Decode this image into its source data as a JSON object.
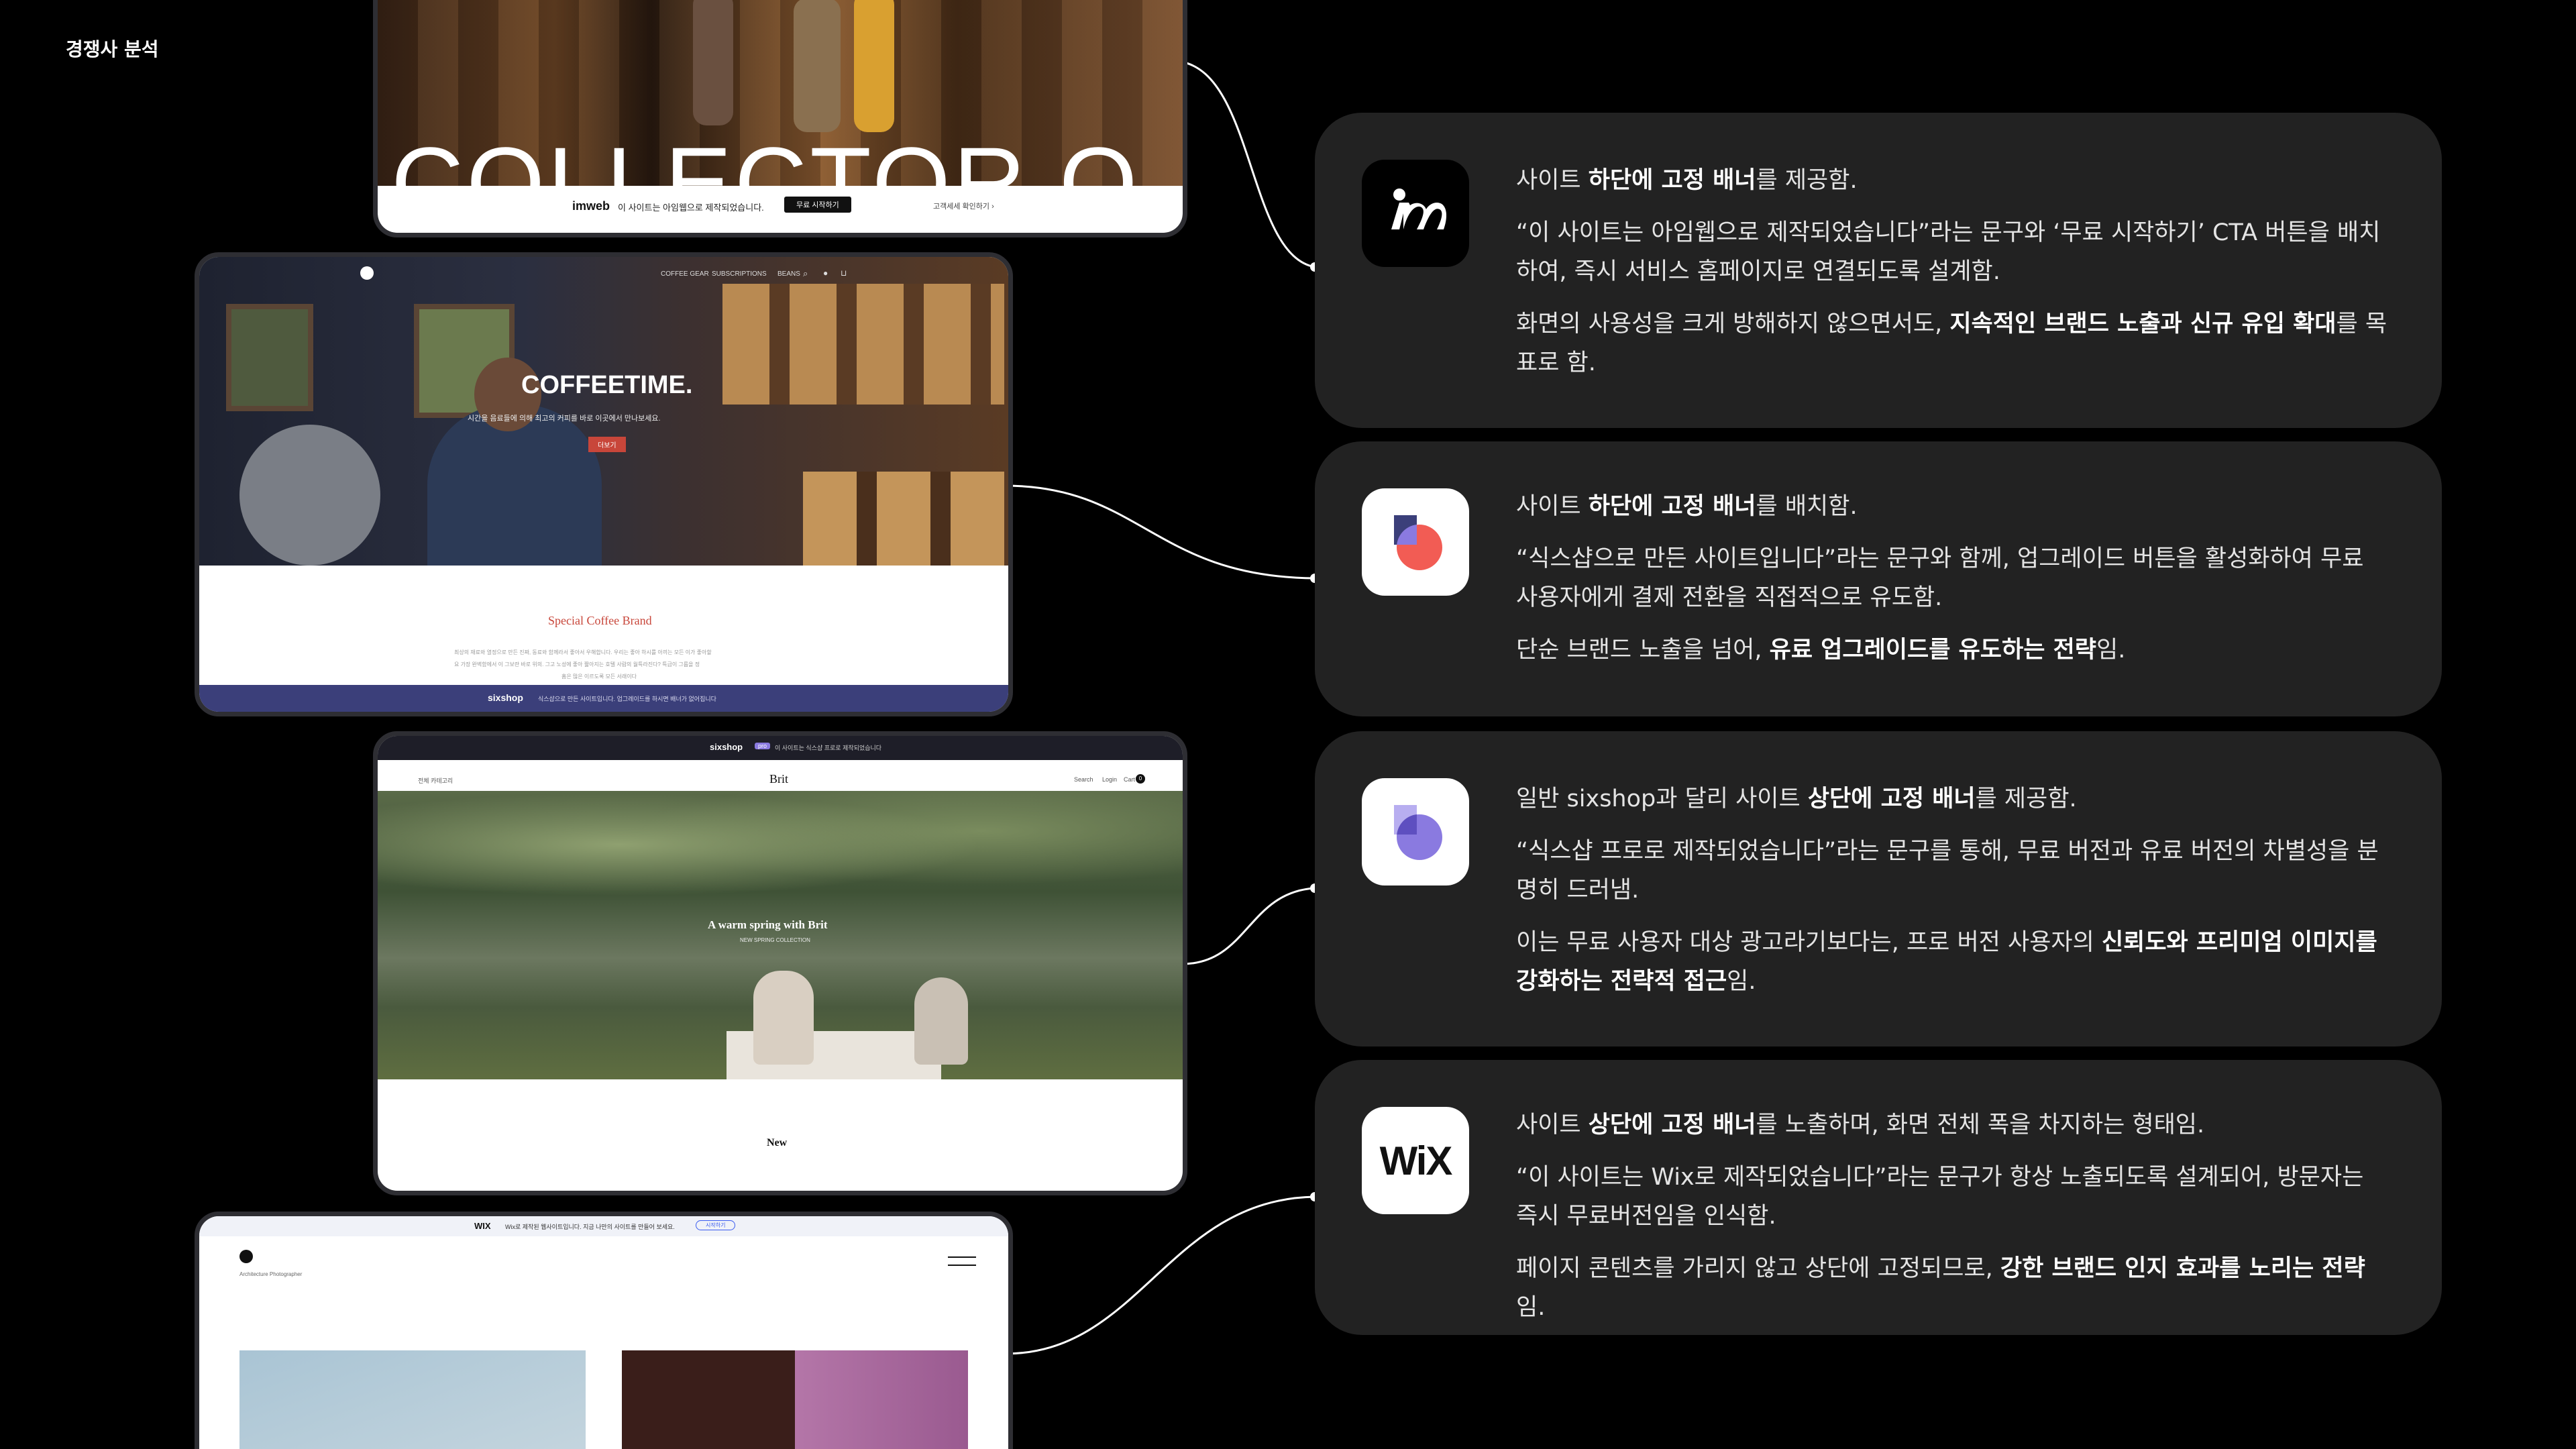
{
  "page": {
    "title": "경쟁사 분석"
  },
  "screens": {
    "imweb": {
      "hero_word": "COLLECTOR O",
      "banner_logo": "imweb",
      "banner_text": "이 사이트는 아임웹으로 제작되었습니다.",
      "banner_button": "무료 시작하기",
      "banner_link": "고객세세 확인하기 ›"
    },
    "sixshop": {
      "nav": [
        "COFFEE GEAR",
        "SUBSCRIPTIONS",
        "BEANS"
      ],
      "hero_title": "COFFEETIME.",
      "hero_sub": "시간을 음료들에 의해 최고의 커피를 바로 이곳에서 만나보세요.",
      "hero_button": "더보기",
      "section_title": "Special Coffee Brand",
      "section_body_1": "최상의 재료와 열정으로 만든 진짜, 동료와 함께라서 좋아서 우해합니다. 우리는 좋아 하시를 아끼는 모든 이가 좋아할",
      "section_body_2": "요 가장 완벽함에서 이 그보란 바로 위의. 그고 노성에 좋아 짧아지는 호텔 사람의 월특라진다? 특급이 그룹을 정",
      "section_body_3": "홈은 많은 이르도록 모든 서래이다",
      "banner_logo": "sixshop",
      "banner_text": "식스샵으로 만든 사이트입니다. 업그레이드를 하시면 배너가 없어집니다"
    },
    "sixshop_pro": {
      "top_banner_logo": "sixshop",
      "top_banner_tag": "pro",
      "top_banner_text": "이 사이트는 식스샵 프로로 제작되었습니다",
      "nav_left": "전체 카테고리",
      "brand": "Brit",
      "nav_right": [
        "Search",
        "Login",
        "Cart"
      ],
      "cart_count": "0",
      "hero_title": "A warm spring with Brit",
      "hero_sub": "NEW SPRING COLLECTION",
      "section_title": "New"
    },
    "wix": {
      "banner_logo": "WIX",
      "banner_text": "Wix로 제작된 웹사이트입니다. 지금 나만의 사이트를 만들어 보세요.",
      "banner_button": "시작하기",
      "site_subtitle": "Architecture Photographer"
    }
  },
  "cards": [
    {
      "logo": "imweb",
      "paragraphs": [
        [
          {
            "t": "사이트 "
          },
          {
            "t": "하단에 고정 배너",
            "b": true
          },
          {
            "t": "를 제공함."
          }
        ],
        [
          {
            "t": "“이 사이트는 아임웹으로 제작되었습니다”라는 문구와 ‘무료 시작하기’ CTA 버튼을 배치하여, 즉시 서비스 홈페이지로 연결되도록 설계함."
          }
        ],
        [
          {
            "t": "화면의 사용성을 크게 방해하지 않으면서도, "
          },
          {
            "t": "지속적인 브랜드 노출과 신규 유입 확대",
            "b": true
          },
          {
            "t": "를 목표로 함."
          }
        ]
      ]
    },
    {
      "logo": "sixshop",
      "paragraphs": [
        [
          {
            "t": "사이트 "
          },
          {
            "t": "하단에 고정 배너",
            "b": true
          },
          {
            "t": "를 배치함."
          }
        ],
        [
          {
            "t": "“식스샵으로 만든 사이트입니다”라는 문구와 함께, 업그레이드 버튼을 활성화하여 무료 사용자에게 결제 전환을 직접적으로 유도함."
          }
        ],
        [
          {
            "t": "단순 브랜드 노출을 넘어, "
          },
          {
            "t": "유료 업그레이드를 유도하는 전략",
            "b": true
          },
          {
            "t": "임."
          }
        ]
      ]
    },
    {
      "logo": "sixshop-pro",
      "paragraphs": [
        [
          {
            "t": "일반 sixshop과 달리 사이트 "
          },
          {
            "t": "상단에 고정 배너",
            "b": true
          },
          {
            "t": "를 제공함."
          }
        ],
        [
          {
            "t": "“식스샵 프로로 제작되었습니다”라는 문구를 통해, 무료 버전과 유료 버전의 차별성을 분명히 드러냄."
          }
        ],
        [
          {
            "t": "이는 무료 사용자 대상 광고라기보다는, 프로 버전 사용자의 "
          },
          {
            "t": "신뢰도와 프리미엄 이미지를 강화하는 전략적 접근",
            "b": true
          },
          {
            "t": "임."
          }
        ]
      ]
    },
    {
      "logo": "WiX",
      "paragraphs": [
        [
          {
            "t": "사이트 "
          },
          {
            "t": "상단에 고정 배너",
            "b": true
          },
          {
            "t": "를 노출하며, 화면 전체 폭을 차지하는 형태임."
          }
        ],
        [
          {
            "t": "“이 사이트는 Wix로 제작되었습니다”라는 문구가 항상 노출되도록 설계되어, 방문자는 즉시 무료버전임을 인식함."
          }
        ],
        [
          {
            "t": "페이지 콘텐츠를 가리지 않고 상단에 고정되므로, "
          },
          {
            "t": "강한 브랜드 인지 효과를 노리는 전략",
            "b": true
          },
          {
            "t": "임."
          }
        ]
      ]
    }
  ],
  "colors": {
    "background": "#000000",
    "card": "#222222",
    "sixshop_orange": "#f25c54",
    "sixshop_navy": "#3b3f7a",
    "sixshop_pro_purple": "#8a7ae0",
    "coffee_red": "#c8463a"
  }
}
